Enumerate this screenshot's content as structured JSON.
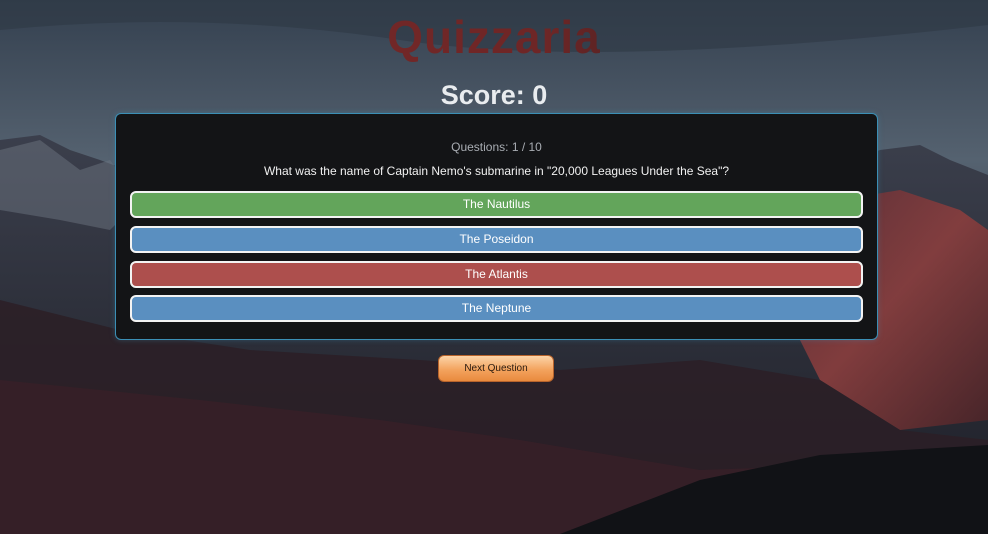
{
  "app": {
    "title": "Quizzaria"
  },
  "score": {
    "label": "Score: 0"
  },
  "quiz": {
    "counter": "Questions: 1 / 10",
    "question": "What was the name of Captain Nemo's submarine in \"20,000 Leagues Under the Sea\"?",
    "answers": [
      {
        "label": "The Nautilus",
        "state": "correct",
        "color": "#63a55b"
      },
      {
        "label": "The Poseidon",
        "state": "neutral",
        "color": "#5a8fc0"
      },
      {
        "label": "The Atlantis",
        "state": "wrong",
        "color": "#ad4f4d"
      },
      {
        "label": "The Neptune",
        "state": "neutral",
        "color": "#5a8fc0"
      }
    ]
  },
  "actions": {
    "next_label": "Next Question"
  },
  "theme": {
    "card_border": "#3b8fb5",
    "button_accent": "#f3a35e"
  }
}
